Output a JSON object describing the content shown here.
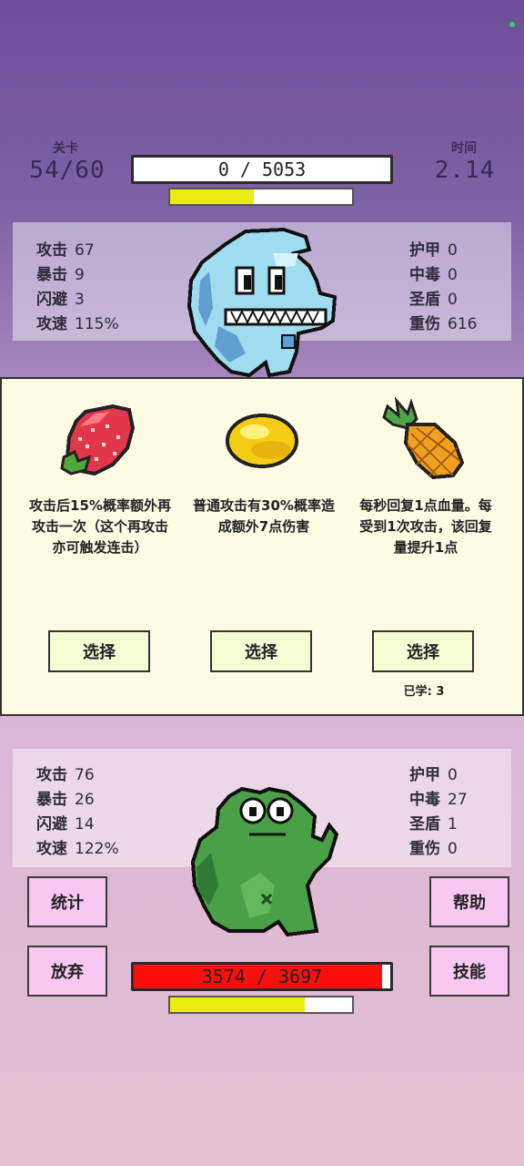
{
  "header": {
    "level_label": "关卡",
    "level_value": "54/60",
    "time_label": "时间",
    "time_value": "2.14"
  },
  "enemy": {
    "hp_text": "0 / 5053",
    "energy_fraction": 0.46,
    "stats_left": [
      {
        "label": "攻击",
        "value": "67"
      },
      {
        "label": "暴击",
        "value": "9"
      },
      {
        "label": "闪避",
        "value": "3"
      },
      {
        "label": "攻速",
        "value": "115%"
      }
    ],
    "stats_right": [
      {
        "label": "护甲",
        "value": "0"
      },
      {
        "label": "中毒",
        "value": "0"
      },
      {
        "label": "圣盾",
        "value": "0"
      },
      {
        "label": "重伤",
        "value": "616"
      }
    ]
  },
  "choices": [
    {
      "icon": "strawberry-icon",
      "desc": "攻击后15%概率额外再攻击一次（这个再攻击亦可触发连击）",
      "button": "选择",
      "learned": ""
    },
    {
      "icon": "lemon-icon",
      "desc": "普通攻击有30%概率造成额外7点伤害",
      "button": "选择",
      "learned": ""
    },
    {
      "icon": "pineapple-icon",
      "desc": "每秒回复1点血量。每受到1次攻击，该回复量提升1点",
      "button": "选择",
      "learned": "已学: 3"
    }
  ],
  "player": {
    "hp_text": "3574 / 3697",
    "hp_fraction": 0.967,
    "energy_fraction": 0.74,
    "stats_left": [
      {
        "label": "攻击",
        "value": "76"
      },
      {
        "label": "暴击",
        "value": "26"
      },
      {
        "label": "闪避",
        "value": "14"
      },
      {
        "label": "攻速",
        "value": "122%"
      }
    ],
    "stats_right": [
      {
        "label": "护甲",
        "value": "0"
      },
      {
        "label": "中毒",
        "value": "27"
      },
      {
        "label": "圣盾",
        "value": "1"
      },
      {
        "label": "重伤",
        "value": "0"
      }
    ]
  },
  "buttons": {
    "stats": "统计",
    "giveup": "放弃",
    "help": "帮助",
    "skills": "技能"
  },
  "colors": {
    "hp_red": "#ff0e0e",
    "energy_yellow": "#ecec12",
    "enemy_blue": "#9fdcef",
    "player_green": "#4aa046"
  }
}
